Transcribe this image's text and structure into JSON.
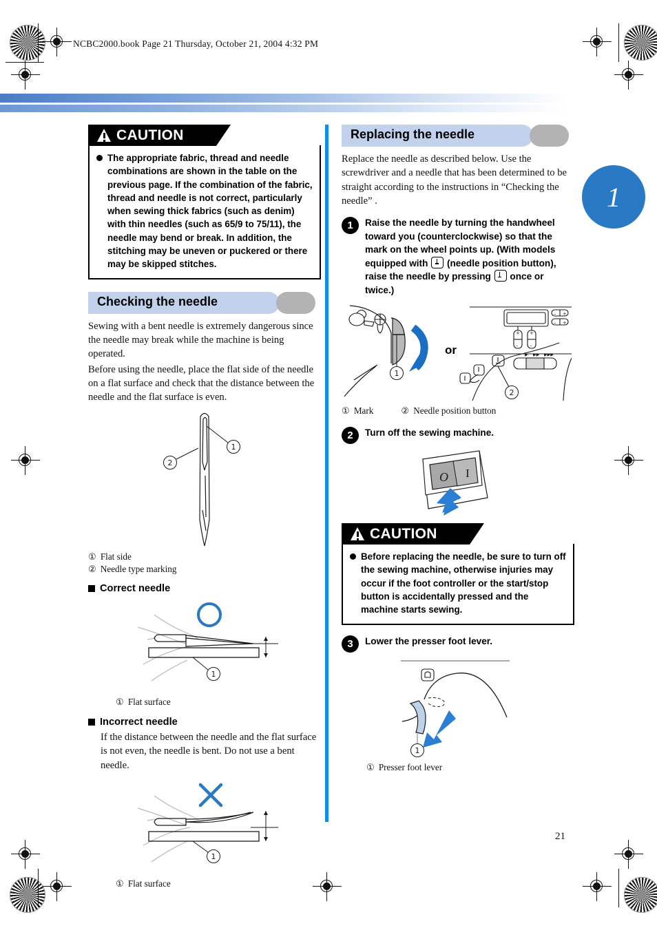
{
  "document": {
    "header_line": "NCBC2000.book  Page 21  Thursday, October 21, 2004  4:32 PM",
    "page_number": "21",
    "chapter_marker": "1",
    "accent_blue": "#0a8ef0",
    "chapter_blue": "#2a79c4",
    "pill_blue": "#c3d2ec",
    "pill_grey": "#b3b3b3"
  },
  "left_column": {
    "caution": {
      "label": "CAUTION",
      "icon": "warning-triangle-icon",
      "text": "The appropriate fabric, thread and needle combinations are shown in the table on the previous page. If the combination of the fabric, thread and needle is not correct, particularly when sewing thick fabrics (such as denim) with thin needles (such as 65/9 to 75/11), the needle may bend or break. In addition, the stitching may be uneven or puckered or there may be skipped stitches."
    },
    "section": {
      "title": "Checking the needle",
      "para1": "Sewing with a bent needle is extremely dangerous since the needle may break while the machine is being operated.",
      "para2": "Before using the needle, place the flat side of the needle on a flat surface and check that the distance between the needle and the flat surface is even."
    },
    "needle_figure": {
      "callout_1_num": "①",
      "callout_1_text": "Flat side",
      "callout_2_num": "②",
      "callout_2_text": "Needle type marking",
      "marker_1": "①",
      "marker_2": "②"
    },
    "correct_needle": {
      "heading": "Correct needle",
      "mark": "circle-ok-mark",
      "callout_num": "①",
      "callout_text": "Flat surface",
      "marker": "①"
    },
    "incorrect_needle": {
      "heading": "Incorrect needle",
      "text": "If the distance between the needle and the flat surface is not even, the needle is bent. Do not use a bent needle.",
      "mark": "cross-ng-mark",
      "callout_num": "①",
      "callout_text": "Flat surface",
      "marker": "①"
    }
  },
  "right_column": {
    "section": {
      "title": "Replacing the needle",
      "intro": "Replace the needle as described below. Use the screwdriver and a needle that has been determined to be straight according to the instructions in “Checking the needle” ."
    },
    "step1": {
      "number": "1",
      "text_part1": "Raise the needle by turning the handwheel toward you (counterclockwise) so that the mark on the wheel points up. (With models equipped with",
      "text_part2": "(needle position button), raise the needle by pressing",
      "text_part3": "once or twice.)",
      "figure": {
        "or_label": "or",
        "marker_1": "①",
        "marker_2": "②",
        "callout_1_num": "①",
        "callout_1_text": "Mark",
        "callout_2_num": "②",
        "callout_2_text": "Needle position button"
      }
    },
    "step2": {
      "number": "2",
      "text": "Turn off the sewing machine.",
      "switch_off_label": "O",
      "switch_on_label": "I"
    },
    "caution": {
      "label": "CAUTION",
      "icon": "warning-triangle-icon",
      "text": "Before replacing the needle, be sure to turn off the sewing machine, otherwise injuries may occur if the foot controller or the start/stop button is accidentally pressed and the machine starts sewing."
    },
    "step3": {
      "number": "3",
      "text": "Lower the presser foot lever.",
      "marker": "①",
      "callout_num": "①",
      "callout_text": "Presser foot lever"
    }
  }
}
